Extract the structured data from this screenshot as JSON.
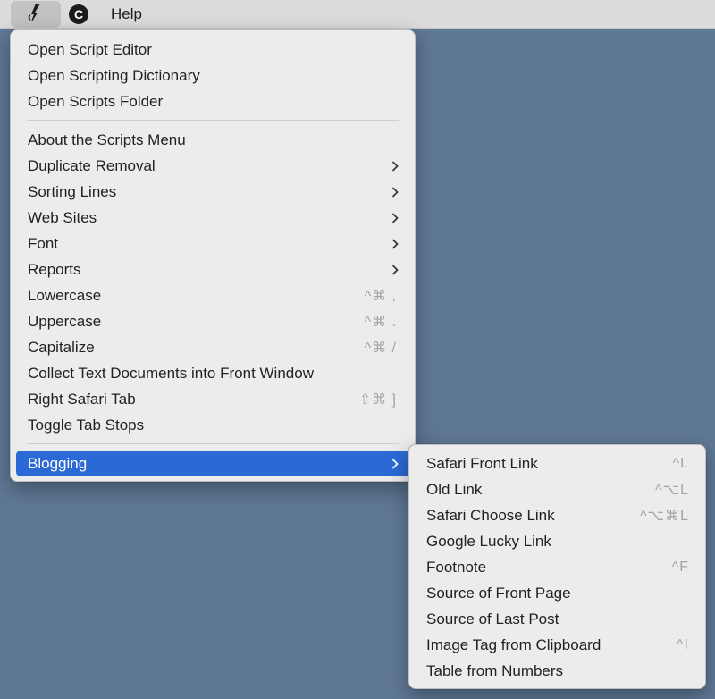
{
  "menubar": {
    "script_menu_icon": "script-icon",
    "c_icon_letter": "C",
    "help_label": "Help"
  },
  "main_menu": {
    "group1": [
      {
        "label": "Open Script Editor"
      },
      {
        "label": "Open Scripting Dictionary"
      },
      {
        "label": "Open Scripts Folder"
      }
    ],
    "group2": [
      {
        "label": "About the Scripts Menu",
        "shortcut": "",
        "submenu": false
      },
      {
        "label": "Duplicate Removal",
        "shortcut": "",
        "submenu": true
      },
      {
        "label": "Sorting Lines",
        "shortcut": "",
        "submenu": true
      },
      {
        "label": "Web Sites",
        "shortcut": "",
        "submenu": true
      },
      {
        "label": "Font",
        "shortcut": "",
        "submenu": true
      },
      {
        "label": "Reports",
        "shortcut": "",
        "submenu": true
      },
      {
        "label": "Lowercase",
        "shortcut": "^⌘ ,",
        "submenu": false
      },
      {
        "label": "Uppercase",
        "shortcut": "^⌘ .",
        "submenu": false
      },
      {
        "label": "Capitalize",
        "shortcut": "^⌘ /",
        "submenu": false
      },
      {
        "label": "Collect Text Documents into Front Window",
        "shortcut": "",
        "submenu": false
      },
      {
        "label": "Right Safari Tab",
        "shortcut": "⇧⌘ ]",
        "submenu": false
      },
      {
        "label": "Toggle Tab Stops",
        "shortcut": "",
        "submenu": false
      }
    ],
    "group3": [
      {
        "label": "Blogging",
        "submenu": true,
        "highlighted": true
      }
    ]
  },
  "blogging_submenu": {
    "items": [
      {
        "label": "Safari Front Link",
        "shortcut": "^L"
      },
      {
        "label": "Old Link",
        "shortcut": "^⌥L"
      },
      {
        "label": "Safari Choose Link",
        "shortcut": "^⌥⌘L"
      },
      {
        "label": "Google Lucky Link",
        "shortcut": ""
      },
      {
        "label": "Footnote",
        "shortcut": "^F"
      },
      {
        "label": "Source of Front Page",
        "shortcut": ""
      },
      {
        "label": "Source of Last Post",
        "shortcut": ""
      },
      {
        "label": "Image Tag from Clipboard",
        "shortcut": "^I"
      },
      {
        "label": "Table from Numbers",
        "shortcut": ""
      }
    ]
  },
  "colors": {
    "desktop": "#5f7896",
    "menu_bg": "#ececec",
    "highlight": "#2b6ad6",
    "shortcut_text": "#a3a3a3"
  }
}
